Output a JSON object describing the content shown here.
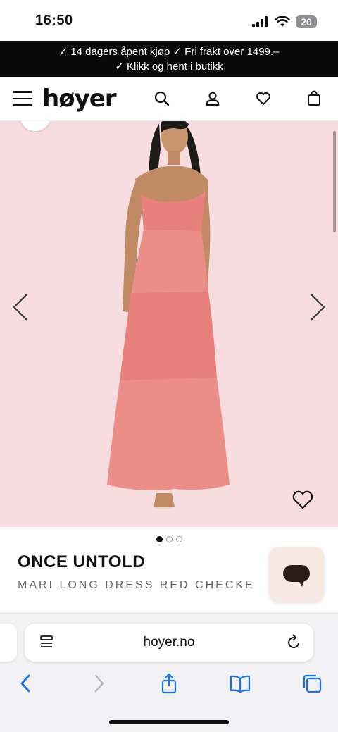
{
  "status_bar": {
    "time": "16:50",
    "battery": "20"
  },
  "promo": {
    "line1": "✓ 14 dagers åpent kjøp   ✓ Fri frakt over 1499.–",
    "line2": "✓ Klikk og hent i butikk"
  },
  "header": {
    "logo": "høyer",
    "icons": [
      "menu-icon",
      "search-icon",
      "account-icon",
      "heart-icon",
      "bag-icon"
    ]
  },
  "gallery": {
    "slide_count": 3,
    "active_slide": 1
  },
  "product": {
    "brand": "ONCE UNTOLD",
    "name": "MARI LONG DRESS RED CHECKE"
  },
  "browser": {
    "url": "hoyer.no",
    "icons": [
      "back-icon",
      "forward-icon",
      "share-icon",
      "bookmarks-icon",
      "tabs-icon"
    ]
  },
  "colors": {
    "accent": "#1a73e8",
    "promo_bg": "#0a0a0a",
    "product_bg": "#f7dde0",
    "dress": "#e8817c"
  }
}
